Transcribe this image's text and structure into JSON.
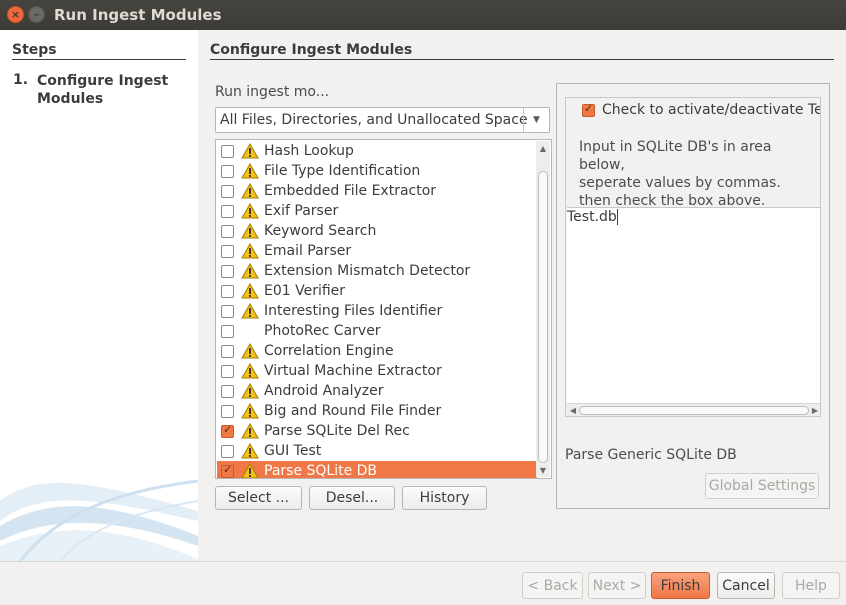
{
  "window": {
    "title": "Run Ingest Modules",
    "close_glyph": "×",
    "minimize_glyph": "–"
  },
  "steps": {
    "title": "Steps",
    "items": [
      {
        "number": "1.",
        "label": "Configure Ingest Modules"
      }
    ]
  },
  "main": {
    "title": "Configure Ingest Modules",
    "run_label": "Run ingest mo...",
    "dropdown_value": "All Files, Directories, and Unallocated Space",
    "modules": [
      {
        "label": "Hash Lookup",
        "checked": false,
        "warning": true,
        "selected": false
      },
      {
        "label": "File Type Identification",
        "checked": false,
        "warning": true,
        "selected": false
      },
      {
        "label": "Embedded File Extractor",
        "checked": false,
        "warning": true,
        "selected": false
      },
      {
        "label": "Exif Parser",
        "checked": false,
        "warning": true,
        "selected": false
      },
      {
        "label": "Keyword Search",
        "checked": false,
        "warning": true,
        "selected": false
      },
      {
        "label": "Email Parser",
        "checked": false,
        "warning": true,
        "selected": false
      },
      {
        "label": "Extension Mismatch Detector",
        "checked": false,
        "warning": true,
        "selected": false
      },
      {
        "label": "E01 Verifier",
        "checked": false,
        "warning": true,
        "selected": false
      },
      {
        "label": "Interesting Files Identifier",
        "checked": false,
        "warning": true,
        "selected": false
      },
      {
        "label": "PhotoRec Carver",
        "checked": false,
        "warning": false,
        "selected": false
      },
      {
        "label": "Correlation Engine",
        "checked": false,
        "warning": true,
        "selected": false
      },
      {
        "label": "Virtual Machine Extractor",
        "checked": false,
        "warning": true,
        "selected": false
      },
      {
        "label": "Android Analyzer",
        "checked": false,
        "warning": true,
        "selected": false
      },
      {
        "label": "Big and Round File Finder",
        "checked": false,
        "warning": true,
        "selected": false
      },
      {
        "label": "Parse SQLite Del Rec",
        "checked": true,
        "warning": true,
        "selected": false
      },
      {
        "label": "GUI Test",
        "checked": false,
        "warning": true,
        "selected": false
      },
      {
        "label": "Parse SQLite DB",
        "checked": true,
        "warning": true,
        "selected": true
      }
    ],
    "buttons": {
      "select": "Select ...",
      "deselect": "Desel...",
      "history": "History"
    }
  },
  "settings": {
    "activate_label": "Check to activate/deactivate Te",
    "activate_checked": true,
    "instructions": [
      "Input in SQLite DB's in area below,",
      "seperate values by commas.",
      "then check the box above."
    ],
    "text_value": "Test.db",
    "module_name": "Parse Generic SQLite DB",
    "global_settings_label": "Global Settings"
  },
  "nav": {
    "back": "< Back",
    "next": "Next >",
    "finish": "Finish",
    "cancel": "Cancel",
    "help": "Help"
  },
  "colors": {
    "accent": "#f07746",
    "titlebar": "#3c3b37",
    "warning_fill": "#f5c211"
  }
}
